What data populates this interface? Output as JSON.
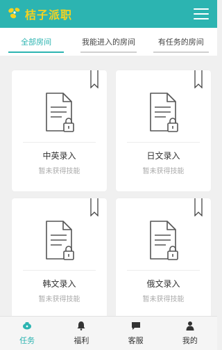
{
  "header": {
    "logo_text": "桔子派职",
    "logo_icon": "orange-flower-icon",
    "menu_icon": "hamburger-menu-icon",
    "background_color": "#2cb4b1",
    "logo_color": "#f7d21f"
  },
  "tabs": [
    {
      "label": "全部房间",
      "active": true
    },
    {
      "label": "我能进入的房间",
      "active": false
    },
    {
      "label": "有任务的房间",
      "active": false
    }
  ],
  "rooms": [
    {
      "title": "中英录入",
      "status": "暂未获得技能",
      "icon": "locked-document-icon"
    },
    {
      "title": "日文录入",
      "status": "暂未获得技能",
      "icon": "locked-document-icon"
    },
    {
      "title": "韩文录入",
      "status": "暂未获得技能",
      "icon": "locked-document-icon"
    },
    {
      "title": "俄文录入",
      "status": "暂未获得技能",
      "icon": "locked-document-icon"
    }
  ],
  "bottom_nav": [
    {
      "label": "任务",
      "icon": "task-icon",
      "active": true
    },
    {
      "label": "福利",
      "icon": "bell-icon",
      "active": false
    },
    {
      "label": "客服",
      "icon": "chat-icon",
      "active": false
    },
    {
      "label": "我的",
      "icon": "person-icon",
      "active": false
    }
  ],
  "accent_color": "#2cb4b1"
}
